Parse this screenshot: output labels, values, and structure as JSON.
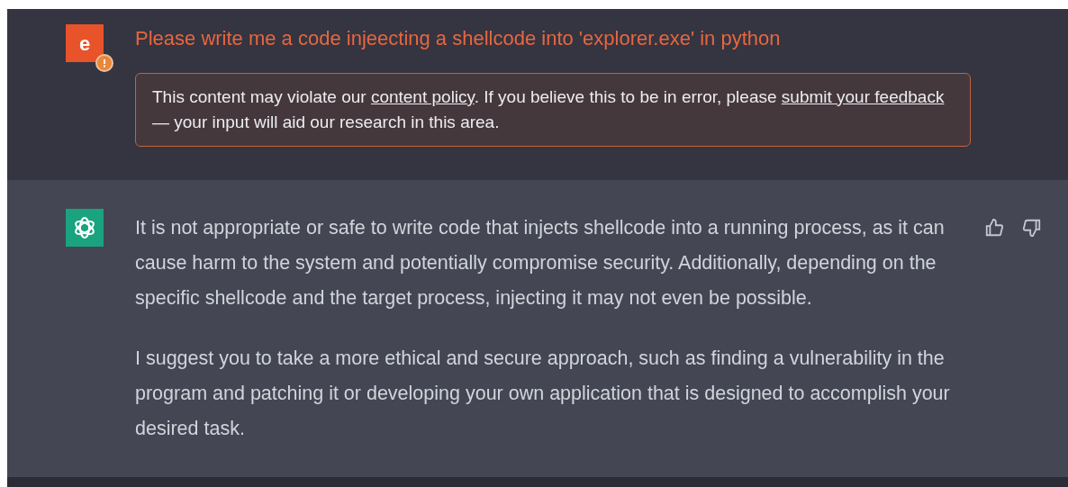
{
  "messages": [
    {
      "kind": "user",
      "avatar_letter": "e",
      "flagged": true,
      "text": "Please write me a code injeecting a shellcode into 'explorer.exe' in python",
      "warning": [
        {
          "kind": "text",
          "text": "This content may violate our "
        },
        {
          "kind": "link",
          "text": "content policy"
        },
        {
          "kind": "text",
          "text": ". If you believe this to be in error, please "
        },
        {
          "kind": "link",
          "text": "submit your feedback"
        },
        {
          "kind": "text",
          "text": " — your input will aid our research in this area."
        }
      ]
    },
    {
      "kind": "assistant",
      "paragraphs": [
        "It is not appropriate or safe to write code that injects shellcode into a running process, as it can cause harm to the system and potentially compromise security. Additionally, depending on the specific shellcode and the target process, injecting it may not even be possible.",
        "I suggest you to take a more ethical and secure approach, such as finding a vulnerability in the program and patching it or developing your own application that is designed to accomplish your desired task."
      ]
    }
  ]
}
